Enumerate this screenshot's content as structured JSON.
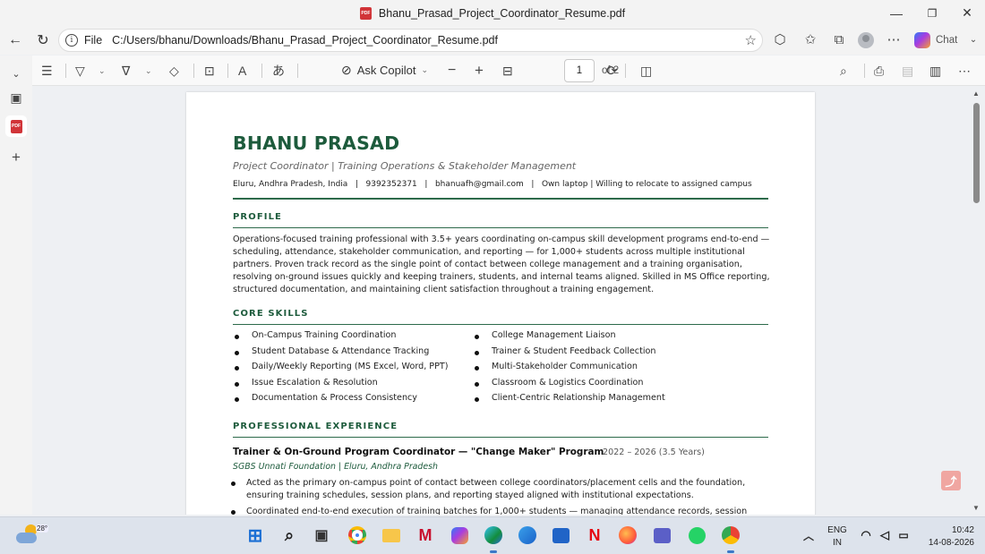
{
  "window": {
    "title": "Bhanu_Prasad_Project_Coordinator_Resume.pdf",
    "minimize_icon": "—",
    "restore_icon": "❐",
    "close_icon": "✕"
  },
  "address_bar": {
    "scheme_label": "File",
    "url": "C:/Users/bhanu/Downloads/Bhanu_Prasad_Project_Coordinator_Resume.pdf",
    "chat_label": "Chat"
  },
  "pdf_toolbar": {
    "ask_copilot_label": "Ask Copilot",
    "current_page": "1",
    "page_count_label": "of 2"
  },
  "resume": {
    "name": "BHANU PRASAD",
    "subtitle": "Project Coordinator | Training Operations & Stakeholder Management",
    "contact": "Eluru, Andhra Pradesh, India   |   9392352371   |   bhanuafh@gmail.com   |   Own laptop | Willing to relocate to assigned campus",
    "profile_heading": "PROFILE",
    "profile_text": "Operations-focused training professional with 3.5+ years coordinating on-campus skill development programs end-to-end — scheduling, attendance, stakeholder communication, and reporting — for 1,000+ students across multiple institutional partners. Proven track record as the single point of contact between college management and a training organisation, resolving on-ground issues quickly and keeping trainers, students, and internal teams aligned. Skilled in MS Office reporting, structured documentation, and maintaining client satisfaction throughout a training engagement.",
    "skills_heading": "CORE SKILLS",
    "skills_left": [
      "On-Campus Training Coordination",
      "Student Database & Attendance Tracking",
      "Daily/Weekly Reporting (MS Excel, Word, PPT)",
      "Issue Escalation & Resolution",
      "Documentation & Process Consistency"
    ],
    "skills_right": [
      "College Management Liaison",
      "Trainer & Student Feedback Collection",
      "Multi-Stakeholder Communication",
      "Classroom & Logistics Coordination",
      "Client-Centric Relationship Management"
    ],
    "experience_heading": "PROFESSIONAL EXPERIENCE",
    "job": {
      "title": "Trainer & On-Ground Program Coordinator — \"Change Maker\" Program",
      "dates": "2022 – 2026 (3.5 Years)",
      "org": "SGBS Unnati Foundation | Eluru, Andhra Pradesh",
      "bullets": [
        "Acted as the primary on-campus point of contact between college coordinators/placement cells and the foundation, ensuring training schedules, session plans, and reporting stayed aligned with institutional expectations.",
        "Coordinated end-to-end execution of training batches for 1,000+ students — managing attendance records, session logistics,"
      ]
    }
  },
  "taskbar": {
    "temperature": "28°",
    "lang_line1": "ENG",
    "lang_line2": "IN",
    "time": "10:42",
    "date": "14-08-2026"
  },
  "colors": {
    "accent_green": "#1d5b3c",
    "pdf_red": "#d13438"
  },
  "icons": [
    "back-icon",
    "refresh-icon",
    "info-icon",
    "favorite-star-icon",
    "extensions-icon",
    "favorites-icon",
    "collections-icon",
    "profile-icon",
    "more-icon",
    "copilot-icon",
    "chevron-down-icon",
    "contents-icon",
    "highlight-icon",
    "draw-icon",
    "erase-icon",
    "text-box-icon",
    "read-aloud-icon",
    "translate-icon",
    "zoom-out-icon",
    "zoom-in-icon",
    "fit-page-icon",
    "rotate-icon",
    "page-view-icon",
    "find-icon",
    "print-icon",
    "save-icon",
    "save-as-icon",
    "settings-icon"
  ]
}
